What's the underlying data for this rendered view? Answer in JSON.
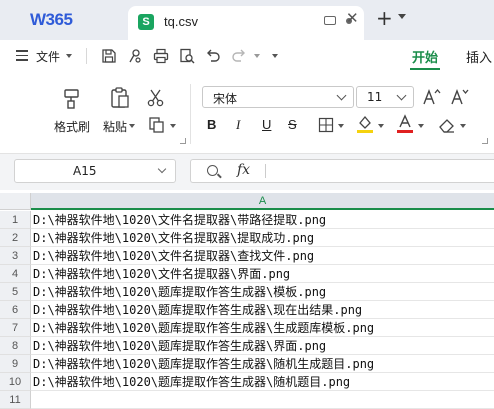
{
  "app": {
    "brand": "W365",
    "tab": {
      "icon_letter": "S",
      "title": "tq.csv"
    },
    "colors": {
      "accent": "#1a8d4a",
      "brand": "#2f5bd8",
      "sheet_icon": "#1aa560"
    }
  },
  "menu": {
    "file_label": "文件",
    "tabs": [
      {
        "label": "开始",
        "active": true
      },
      {
        "label": "插入",
        "active": false
      }
    ]
  },
  "ribbon": {
    "format_painter": "格式刷",
    "paste": "粘贴",
    "font_name": "宋体",
    "font_size": "11"
  },
  "formula_bar": {
    "name_box": "A15",
    "fx_label": "fx",
    "value": ""
  },
  "sheet": {
    "column_headers": [
      "A"
    ],
    "rows": [
      {
        "num": "1",
        "a": "D:\\神器软件地\\1020\\文件名提取器\\带路径提取.png"
      },
      {
        "num": "2",
        "a": "D:\\神器软件地\\1020\\文件名提取器\\提取成功.png"
      },
      {
        "num": "3",
        "a": "D:\\神器软件地\\1020\\文件名提取器\\查找文件.png"
      },
      {
        "num": "4",
        "a": "D:\\神器软件地\\1020\\文件名提取器\\界面.png"
      },
      {
        "num": "5",
        "a": "D:\\神器软件地\\1020\\题库提取作答生成器\\模板.png"
      },
      {
        "num": "6",
        "a": "D:\\神器软件地\\1020\\题库提取作答生成器\\现在出结果.png"
      },
      {
        "num": "7",
        "a": "D:\\神器软件地\\1020\\题库提取作答生成器\\生成题库模板.png"
      },
      {
        "num": "8",
        "a": "D:\\神器软件地\\1020\\题库提取作答生成器\\界面.png"
      },
      {
        "num": "9",
        "a": "D:\\神器软件地\\1020\\题库提取作答生成器\\随机生成题目.png"
      },
      {
        "num": "10",
        "a": "D:\\神器软件地\\1020\\题库提取作答生成器\\随机题目.png"
      },
      {
        "num": "11",
        "a": ""
      }
    ]
  }
}
